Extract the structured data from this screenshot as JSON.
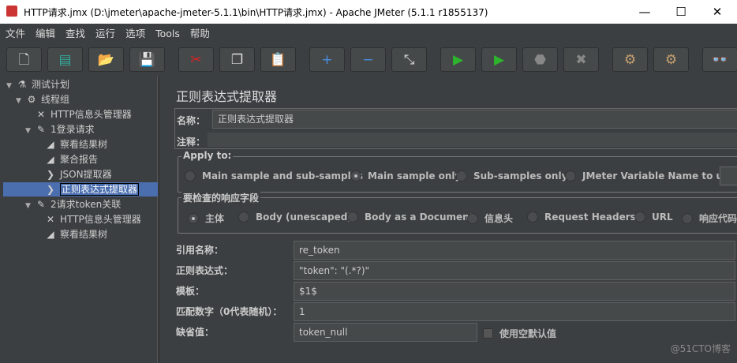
{
  "window": {
    "title": "HTTP请求.jmx (D:\\jmeter\\apache-jmeter-5.1.1\\bin\\HTTP请求.jmx) - Apache JMeter (5.1.1 r1855137)",
    "minimize": "—",
    "maximize": "☐",
    "close": "✕"
  },
  "menu": [
    "文件",
    "编辑",
    "查找",
    "运行",
    "选项",
    "Tools",
    "帮助"
  ],
  "toolbar": [
    {
      "name": "new",
      "glyph": "🗋"
    },
    {
      "name": "templates",
      "glyph": "▤"
    },
    {
      "name": "open",
      "glyph": "📂"
    },
    {
      "name": "save",
      "glyph": "💾"
    },
    {
      "name": "cut",
      "glyph": "✂"
    },
    {
      "name": "copy",
      "glyph": "❐"
    },
    {
      "name": "paste",
      "glyph": "📋"
    },
    {
      "name": "expand",
      "glyph": "+"
    },
    {
      "name": "collapse",
      "glyph": "−"
    },
    {
      "name": "toggle",
      "glyph": "⤡"
    },
    {
      "name": "start",
      "glyph": "▶"
    },
    {
      "name": "start-no-pauses",
      "glyph": "▶"
    },
    {
      "name": "stop",
      "glyph": "⬣"
    },
    {
      "name": "shutdown",
      "glyph": "✖"
    },
    {
      "name": "clear",
      "glyph": "⚙"
    },
    {
      "name": "clear-all",
      "glyph": "⚙"
    },
    {
      "name": "search",
      "glyph": "👓"
    }
  ],
  "tree": [
    {
      "label": "测试计划",
      "icon": "flask-icon",
      "glyph": "⚗",
      "level": 0,
      "expanded": true
    },
    {
      "label": "线程组",
      "icon": "gear-icon",
      "glyph": "⚙",
      "level": 1,
      "expanded": true
    },
    {
      "label": "HTTP信息头管理器",
      "icon": "tools-icon",
      "glyph": "✕",
      "level": 2
    },
    {
      "label": "1登录请求",
      "icon": "pipette-icon",
      "glyph": "✎",
      "level": 2,
      "expanded": true
    },
    {
      "label": "察看结果树",
      "icon": "graph-icon",
      "glyph": "◢",
      "level": 3
    },
    {
      "label": "聚合报告",
      "icon": "graph-icon",
      "glyph": "◢",
      "level": 3
    },
    {
      "label": "JSON提取器",
      "icon": "extractor-icon",
      "glyph": "❯",
      "level": 3
    },
    {
      "label": "正则表达式提取器",
      "icon": "extractor-icon",
      "glyph": "❯",
      "level": 3,
      "selected": true
    },
    {
      "label": "2请求token关联",
      "icon": "pipette-icon",
      "glyph": "✎",
      "level": 2,
      "expanded": true
    },
    {
      "label": "HTTP信息头管理器",
      "icon": "tools-icon",
      "glyph": "✕",
      "level": 3
    },
    {
      "label": "察看结果树",
      "icon": "graph-icon",
      "glyph": "◢",
      "level": 3
    }
  ],
  "panel": {
    "title": "正则表达式提取器",
    "name_label": "名称：",
    "name_value": "正则表达式提取器",
    "comment_label": "注释：",
    "comment_value": "",
    "apply_to": {
      "legend": "Apply to:",
      "options": [
        "Main sample and sub-samples",
        "Main sample only",
        "Sub-samples only",
        "JMeter Variable Name to use"
      ],
      "selected": 1
    },
    "field": {
      "legend": "要检查的响应字段",
      "options": [
        "主体",
        "Body (unescaped)",
        "Body as a Document",
        "信息头",
        "Request Headers",
        "URL",
        "响应代码"
      ],
      "selected": 0
    },
    "ref_label": "引用名称：",
    "ref_value": "re_token",
    "regex_label": "正则表达式：",
    "regex_value": "\"token\": \"(.*?)\"",
    "template_label": "模板：",
    "template_value": "$1$",
    "match_label": "匹配数字（0代表随机）：",
    "match_value": "1",
    "default_label": "缺省值：",
    "default_value": "token_null",
    "empty_default_label": "使用空默认值"
  },
  "watermark": "@51CTO博客"
}
